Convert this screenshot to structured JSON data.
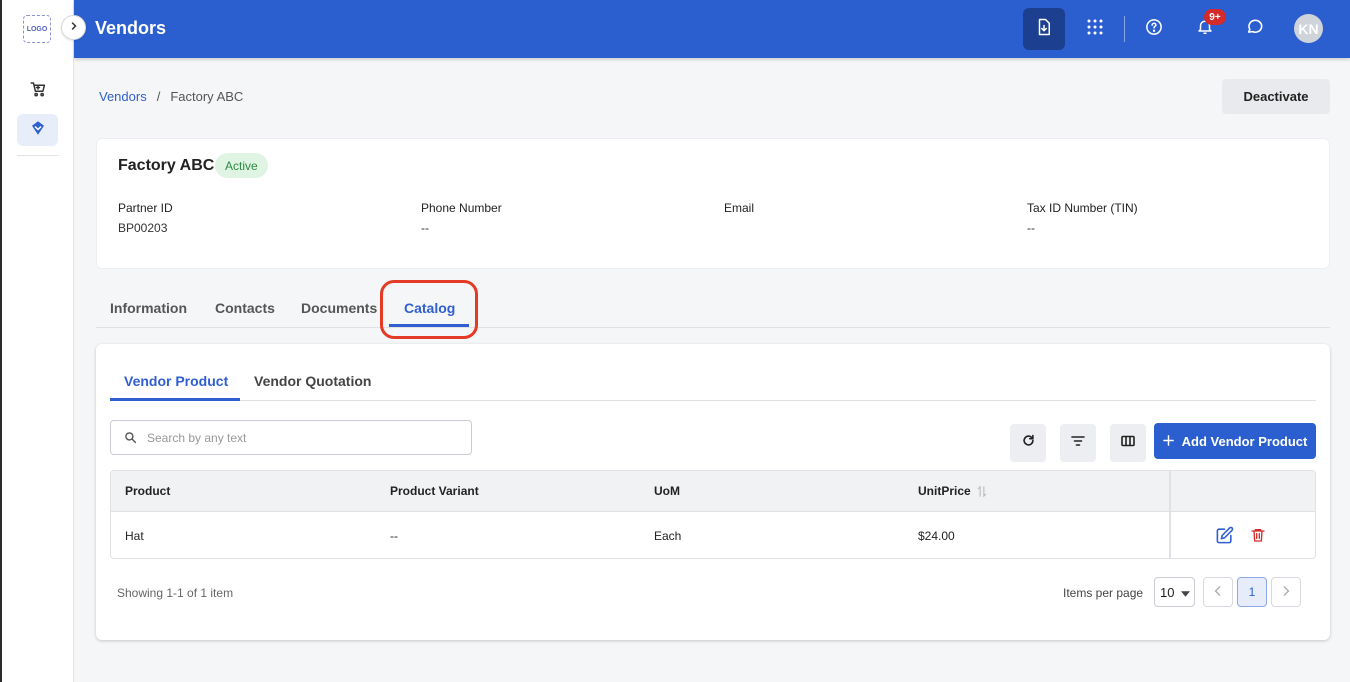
{
  "sidebar": {
    "logo_text": "LOGO",
    "items": [
      {
        "icon": "cart-icon",
        "active": false
      },
      {
        "icon": "tag-icon",
        "active": true
      }
    ]
  },
  "header": {
    "title": "Vendors",
    "notification_count": "9+",
    "avatar_initials": "KN"
  },
  "breadcrumb": {
    "parent": "Vendors",
    "separator": "/",
    "current": "Factory ABC"
  },
  "actions": {
    "deactivate_label": "Deactivate"
  },
  "vendor": {
    "name": "Factory ABC",
    "status": "Active",
    "fields": [
      {
        "label": "Partner ID",
        "value": "BP00203"
      },
      {
        "label": "Phone Number",
        "value": "--"
      },
      {
        "label": "Email",
        "value": ""
      },
      {
        "label": "Tax ID Number (TIN)",
        "value": "--"
      }
    ]
  },
  "tabs": [
    "Information",
    "Contacts",
    "Documents",
    "Catalog"
  ],
  "active_tab": "Catalog",
  "catalog": {
    "subtabs": [
      "Vendor Product",
      "Vendor Quotation"
    ],
    "active_subtab": "Vendor Product",
    "search_placeholder": "Search by any text",
    "add_button_label": "Add Vendor Product",
    "columns": [
      "Product",
      "Product Variant",
      "UoM",
      "UnitPrice"
    ],
    "rows": [
      {
        "product": "Hat",
        "variant": "--",
        "uom": "Each",
        "unit_price": "$24.00"
      }
    ],
    "showing_text": "Showing 1-1 of 1 item",
    "items_per_page_label": "Items per page",
    "items_per_page": "10",
    "current_page": "1"
  },
  "colors": {
    "primary": "#2b5fcf",
    "highlight": "#e33b26",
    "status_bg": "#dff4e3",
    "status_text": "#2f8a43",
    "delete": "#d42a2a"
  }
}
